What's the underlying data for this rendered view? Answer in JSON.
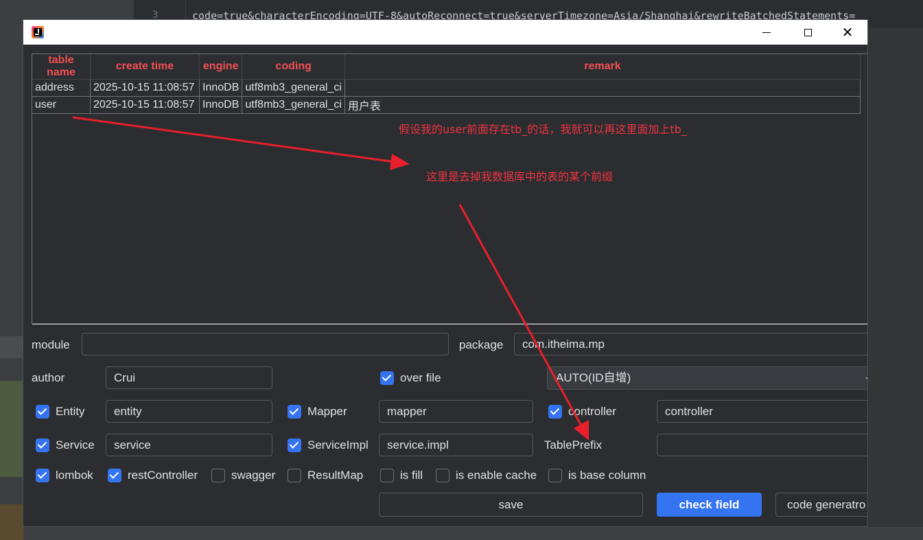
{
  "background": {
    "line_number": "3",
    "code_line": "code=true&characterEncoding=UTF-8&autoReconnect=true&serverTimezone=Asia/Shanghai&rewriteBatchedStatements="
  },
  "window": {
    "icon": "intellij-idea-icon",
    "minimize_icon": "minimize-icon",
    "maximize_icon": "maximize-icon",
    "close_icon": "close-icon"
  },
  "table": {
    "headers": [
      "table name",
      "create time",
      "engine",
      "coding",
      "remark"
    ],
    "rows": [
      [
        "address",
        "2025-10-15 11:08:57",
        "InnoDB",
        "utf8mb3_general_ci",
        ""
      ],
      [
        "user",
        "2025-10-15 11:08:57",
        "InnoDB",
        "utf8mb3_general_ci",
        "用户表"
      ]
    ],
    "header_color": "#f25055"
  },
  "annotations": {
    "note1": "假设我的user前面存在tb_的话，我就可以再这里面加上tb_",
    "note2": "这里是去掉我数据库中的表的某个前缀",
    "color": "#ee3340"
  },
  "form": {
    "module_label": "module",
    "module_value": "",
    "package_label": "package",
    "package_value": "com.itheima.mp",
    "author_label": "author",
    "author_value": "Crui",
    "over_file_label": "over file",
    "over_file_checked": true,
    "id_type_value": "AUTO(ID自增)",
    "entity_label": "Entity",
    "entity_checked": true,
    "entity_value": "entity",
    "mapper_label": "Mapper",
    "mapper_checked": true,
    "mapper_value": "mapper",
    "controller_label": "controller",
    "controller_checked": true,
    "controller_value": "controller",
    "service_label": "Service",
    "service_checked": true,
    "service_value": "service",
    "serviceimpl_label": "ServiceImpl",
    "serviceimpl_checked": true,
    "serviceimpl_value": "service.impl",
    "tableprefix_label": "TablePrefix",
    "tableprefix_value": "",
    "lombok_label": "lombok",
    "lombok_checked": true,
    "restcontroller_label": "restController",
    "restcontroller_checked": true,
    "swagger_label": "swagger",
    "swagger_checked": false,
    "resultmap_label": "ResultMap",
    "resultmap_checked": false,
    "isfill_label": "is fill",
    "isfill_checked": false,
    "enablecache_label": "is enable cache",
    "enablecache_checked": false,
    "basecolumn_label": "is base column",
    "basecolumn_checked": false
  },
  "buttons": {
    "save": "save",
    "check_field": "check field",
    "code_generator": "code generatro"
  },
  "colors": {
    "accent": "#3574f0",
    "background": "#2b2d30"
  }
}
